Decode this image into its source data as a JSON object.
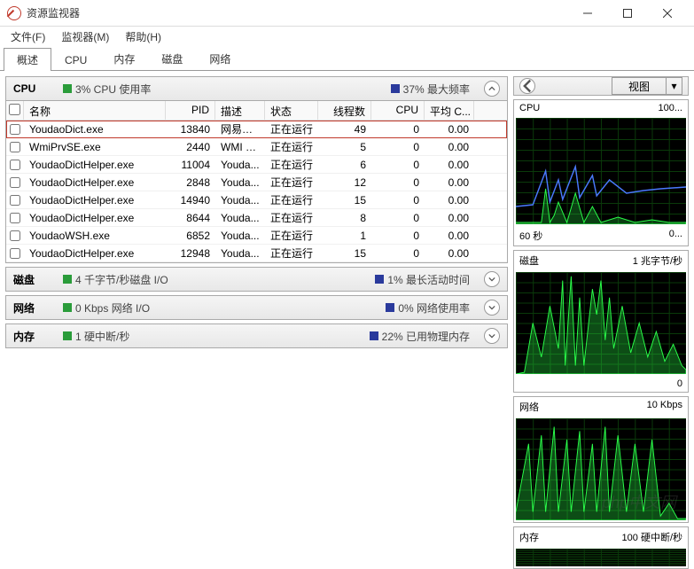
{
  "window": {
    "title": "资源监视器"
  },
  "menubar": {
    "file": "文件(F)",
    "monitor": "监视器(M)",
    "help": "帮助(H)"
  },
  "tabs": {
    "overview": "概述",
    "cpu": "CPU",
    "memory": "内存",
    "disk": "磁盘",
    "network": "网络"
  },
  "cpu_section": {
    "title": "CPU",
    "usage_label": "3% CPU 使用率",
    "freq_label": "37% 最大频率",
    "columns": {
      "name": "名称",
      "pid": "PID",
      "desc": "描述",
      "status": "状态",
      "threads": "线程数",
      "cpu": "CPU",
      "avg": "平均 C..."
    },
    "rows": [
      {
        "name": "YoudaoDict.exe",
        "pid": "13840",
        "desc": "网易有...",
        "status": "正在运行",
        "threads": "49",
        "cpu": "0",
        "avg": "0.00",
        "selected": true
      },
      {
        "name": "WmiPrvSE.exe",
        "pid": "2440",
        "desc": "WMI P...",
        "status": "正在运行",
        "threads": "5",
        "cpu": "0",
        "avg": "0.00"
      },
      {
        "name": "YoudaoDictHelper.exe",
        "pid": "11004",
        "desc": "Youda...",
        "status": "正在运行",
        "threads": "6",
        "cpu": "0",
        "avg": "0.00"
      },
      {
        "name": "YoudaoDictHelper.exe",
        "pid": "2848",
        "desc": "Youda...",
        "status": "正在运行",
        "threads": "12",
        "cpu": "0",
        "avg": "0.00"
      },
      {
        "name": "YoudaoDictHelper.exe",
        "pid": "14940",
        "desc": "Youda...",
        "status": "正在运行",
        "threads": "15",
        "cpu": "0",
        "avg": "0.00"
      },
      {
        "name": "YoudaoDictHelper.exe",
        "pid": "8644",
        "desc": "Youda...",
        "status": "正在运行",
        "threads": "8",
        "cpu": "0",
        "avg": "0.00"
      },
      {
        "name": "YoudaoWSH.exe",
        "pid": "6852",
        "desc": "Youda...",
        "status": "正在运行",
        "threads": "1",
        "cpu": "0",
        "avg": "0.00"
      },
      {
        "name": "YoudaoDictHelper.exe",
        "pid": "12948",
        "desc": "Youda...",
        "status": "正在运行",
        "threads": "15",
        "cpu": "0",
        "avg": "0.00"
      }
    ]
  },
  "disk_section": {
    "title": "磁盘",
    "stat1": "4 千字节/秒磁盘 I/O",
    "stat2": "1% 最长活动时间"
  },
  "network_section": {
    "title": "网络",
    "stat1": "0 Kbps 网络 I/O",
    "stat2": "0% 网络使用率"
  },
  "memory_section": {
    "title": "内存",
    "stat1": "1 硬中断/秒",
    "stat2": "22% 已用物理内存"
  },
  "view_button": "视图",
  "graphs": {
    "cpu": {
      "title": "CPU",
      "right": "100...",
      "footer_left": "60 秒",
      "footer_right": "0..."
    },
    "disk": {
      "title": "磁盘",
      "right": "1 兆字节/秒",
      "footer_left": "",
      "footer_right": "0"
    },
    "network": {
      "title": "网络",
      "right": "10 Kbps"
    },
    "memory": {
      "title": "内存",
      "right": "100 硬中断/秒"
    }
  }
}
